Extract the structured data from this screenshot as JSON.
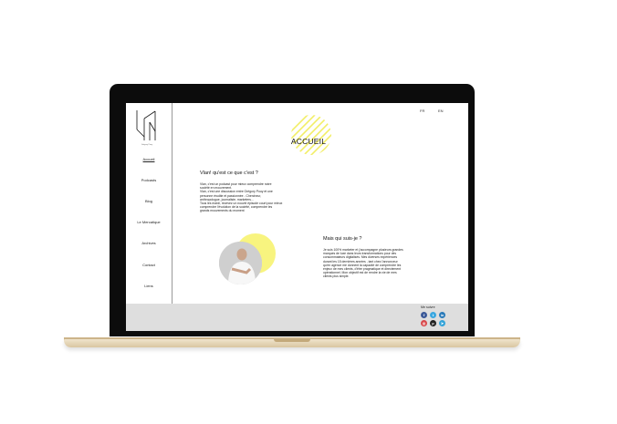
{
  "sidebar": {
    "logo_caption": "Grégory Pouy",
    "items": [
      {
        "label": "Accueil",
        "active": true
      },
      {
        "label": "Podcasts"
      },
      {
        "label": "Blog"
      },
      {
        "label": "Le Mercatique"
      },
      {
        "label": "Archives"
      },
      {
        "label": "Contact"
      },
      {
        "label": "Liens"
      }
    ]
  },
  "header": {
    "lang_fr": "FR",
    "lang_en": "EN",
    "title": "ACCUEIL"
  },
  "intro": {
    "heading": "Vlan! qu'est ce que c'est ?",
    "lines": [
      "Vlan, c'est un podcast pour mieux comprendre notre",
      "société en mouvement.",
      "Vlan, c'est une discussion entre Grégory Pouy et une",
      "personne érudite et passionnée - Chercheur,",
      "anthropologue, journaliste, marketers...",
      "Tous les mardi, recevez un nouvel épisode court pour mieux",
      "comprendre l'évolution de la société, comprendre les",
      "grands mouvements du moment"
    ]
  },
  "about": {
    "heading": "Mais qui suis-je ?",
    "lines": [
      "Je suis 100% marketer et j'accompagne plusieurs grandes",
      "marques de luxe dans leurs transformations pour des",
      "consommateurs digitalisés. Mes diverses expériences",
      "durant les 15 dernières années , tant chez l'annonceur",
      "qu'en agence me donnent la capacité de comprendre les",
      "enjeux de mes clients, d'être pragmatique et directement",
      "opérationnel. Mon objectif est de rendre la vie de mes",
      "clients plus simple."
    ]
  },
  "footer": {
    "follow_label": "Me suivre",
    "social_icons": [
      "facebook-icon",
      "twitter-icon",
      "linkedin-icon",
      "instagram-icon",
      "pinterest-icon",
      "telegram-icon"
    ]
  },
  "colors": {
    "accent_yellow": "#f8f47f",
    "footer_gray": "#dedede",
    "bezel": "#0c0c0c",
    "laptop_gold": "#e3d1ae"
  }
}
